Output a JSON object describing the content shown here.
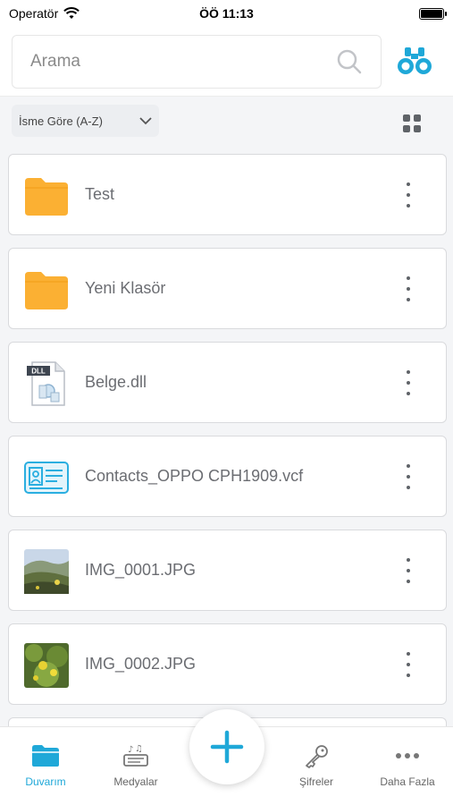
{
  "status_bar": {
    "carrier": "Operatör",
    "time": "ÖÖ 11:13"
  },
  "search": {
    "placeholder": "Arama"
  },
  "sort": {
    "label": "İsme Göre (A-Z)"
  },
  "files": [
    {
      "name": "Test",
      "icon": "folder-icon"
    },
    {
      "name": "Yeni Klasör",
      "icon": "folder-icon"
    },
    {
      "name": "Belge.dll",
      "icon": "dll-file-icon"
    },
    {
      "name": "Contacts_OPPO CPH1909.vcf",
      "icon": "vcard-icon"
    },
    {
      "name": "IMG_0001.JPG",
      "icon": "image-thumbnail"
    },
    {
      "name": "IMG_0002.JPG",
      "icon": "image-thumbnail"
    }
  ],
  "dll_badge": "DLL",
  "tabs": {
    "duvarim": "Duvarım",
    "medyalar": "Medyalar",
    "sifreler": "Şifreler",
    "daha_fazla": "Daha Fazla"
  },
  "colors": {
    "accent": "#1fa8d8",
    "folder": "#fbb033",
    "text_secondary": "#6b6d72"
  }
}
